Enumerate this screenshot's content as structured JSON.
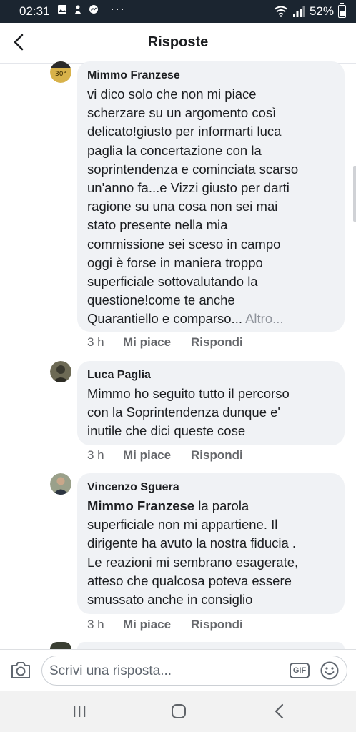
{
  "status_bar": {
    "time": "02:31",
    "dots": "···",
    "battery": "52%",
    "battery_level": 0.52
  },
  "header": {
    "title": "Risposte"
  },
  "comments": [
    {
      "author": "Mimmo Franzese",
      "lines": [
        "vi dico solo che  non mi piace",
        "scherzare su un argomento così",
        "delicato!giusto per informarti luca",
        "paglia la concertazione con la",
        "soprintendenza e cominciata scarso",
        "un'anno fa...e Vizzi giusto per darti",
        "ragione su una cosa non sei mai",
        "stato presente nella mia",
        "commissione sei sceso in campo",
        "oggi è forse in maniera troppo",
        "superficiale sottovalutando la",
        "questione!come te anche"
      ],
      "last_line": "Quarantiello e comparso...",
      "more": " Altro...",
      "time": "3 h",
      "like": "Mi piace",
      "reply": "Rispondi"
    },
    {
      "author": "Luca Paglia",
      "lines": [
        "Mimmo ho seguito tutto il percorso",
        "con la Soprintendenza dunque e'",
        "inutile che dici queste cose"
      ],
      "time": "3 h",
      "like": "Mi piace",
      "reply": "Rispondi"
    },
    {
      "author": "Vincenzo Sguera",
      "mention": "Mimmo Franzese",
      "first_line_rest": " la parola",
      "lines": [
        "superficiale non mi appartiene. Il",
        "dirigente ha avuto la nostra fiducia .",
        "Le reazioni mi sembrano esagerate,",
        "atteso che qualcosa poteva essere",
        "smussato anche in consiglio"
      ],
      "time": "3 h",
      "like": "Mi piace",
      "reply": "Rispondi"
    }
  ],
  "input": {
    "placeholder": "Scrivi una risposta...",
    "gif_label": "GIF"
  },
  "colors": {
    "status_bar": "#1b2530",
    "bubble": "#f0f2f5",
    "secondary_text": "#65676b"
  }
}
